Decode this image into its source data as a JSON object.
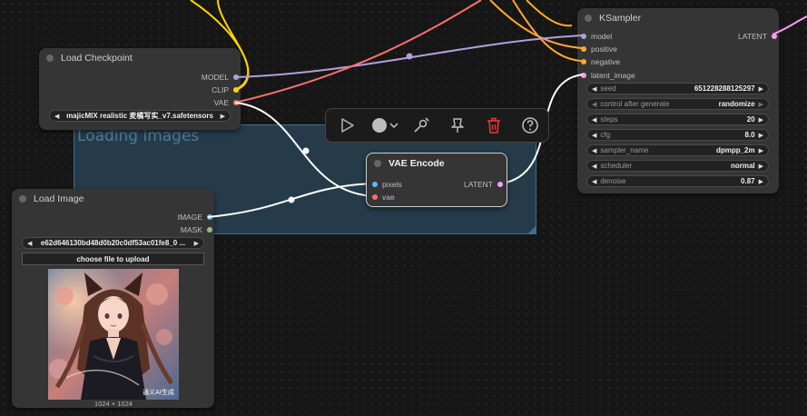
{
  "group": {
    "title": "Loading images"
  },
  "colors": {
    "model": "#b39ddb",
    "clip": "#ffd500",
    "vae": "#ff6e6e",
    "image": "#64b5f6",
    "mask": "#81c784",
    "latent": "#ff9cf9",
    "conditioning": "#ffa931",
    "delete": "#e53935"
  },
  "load_checkpoint": {
    "title": "Load Checkpoint",
    "outputs": [
      "MODEL",
      "CLIP",
      "VAE"
    ],
    "ckpt_name": "majicMIX realistic 麦橘写实_v7.safetensors"
  },
  "vae_encode": {
    "title": "VAE Encode",
    "inputs": [
      "pixels",
      "vae"
    ],
    "output": "LATENT"
  },
  "load_image": {
    "title": "Load Image",
    "outputs": [
      "IMAGE",
      "MASK"
    ],
    "image_name": "e62d646130bd48d0b20c0df53ac01fe8_0 ...",
    "upload_label": "choose file to upload",
    "dimensions": "1024 × 1024",
    "watermark": "通义AI生成"
  },
  "ksampler": {
    "title": "KSampler",
    "inputs": [
      "model",
      "positive",
      "negative",
      "latent_image"
    ],
    "output": "LATENT",
    "widgets": [
      {
        "label": "seed",
        "value": "651228288125297"
      },
      {
        "label": "control after generate",
        "value": "randomize"
      },
      {
        "label": "steps",
        "value": "20"
      },
      {
        "label": "cfg",
        "value": "8.0"
      },
      {
        "label": "sampler_name",
        "value": "dpmpp_2m"
      },
      {
        "label": "scheduler",
        "value": "normal"
      },
      {
        "label": "denoise",
        "value": "0.87"
      }
    ]
  },
  "toolbar": {
    "icons": [
      "play-icon",
      "color-circle-icon",
      "chevron-down-icon",
      "bypass-icon",
      "pin-icon",
      "trash-icon",
      "help-icon"
    ]
  }
}
